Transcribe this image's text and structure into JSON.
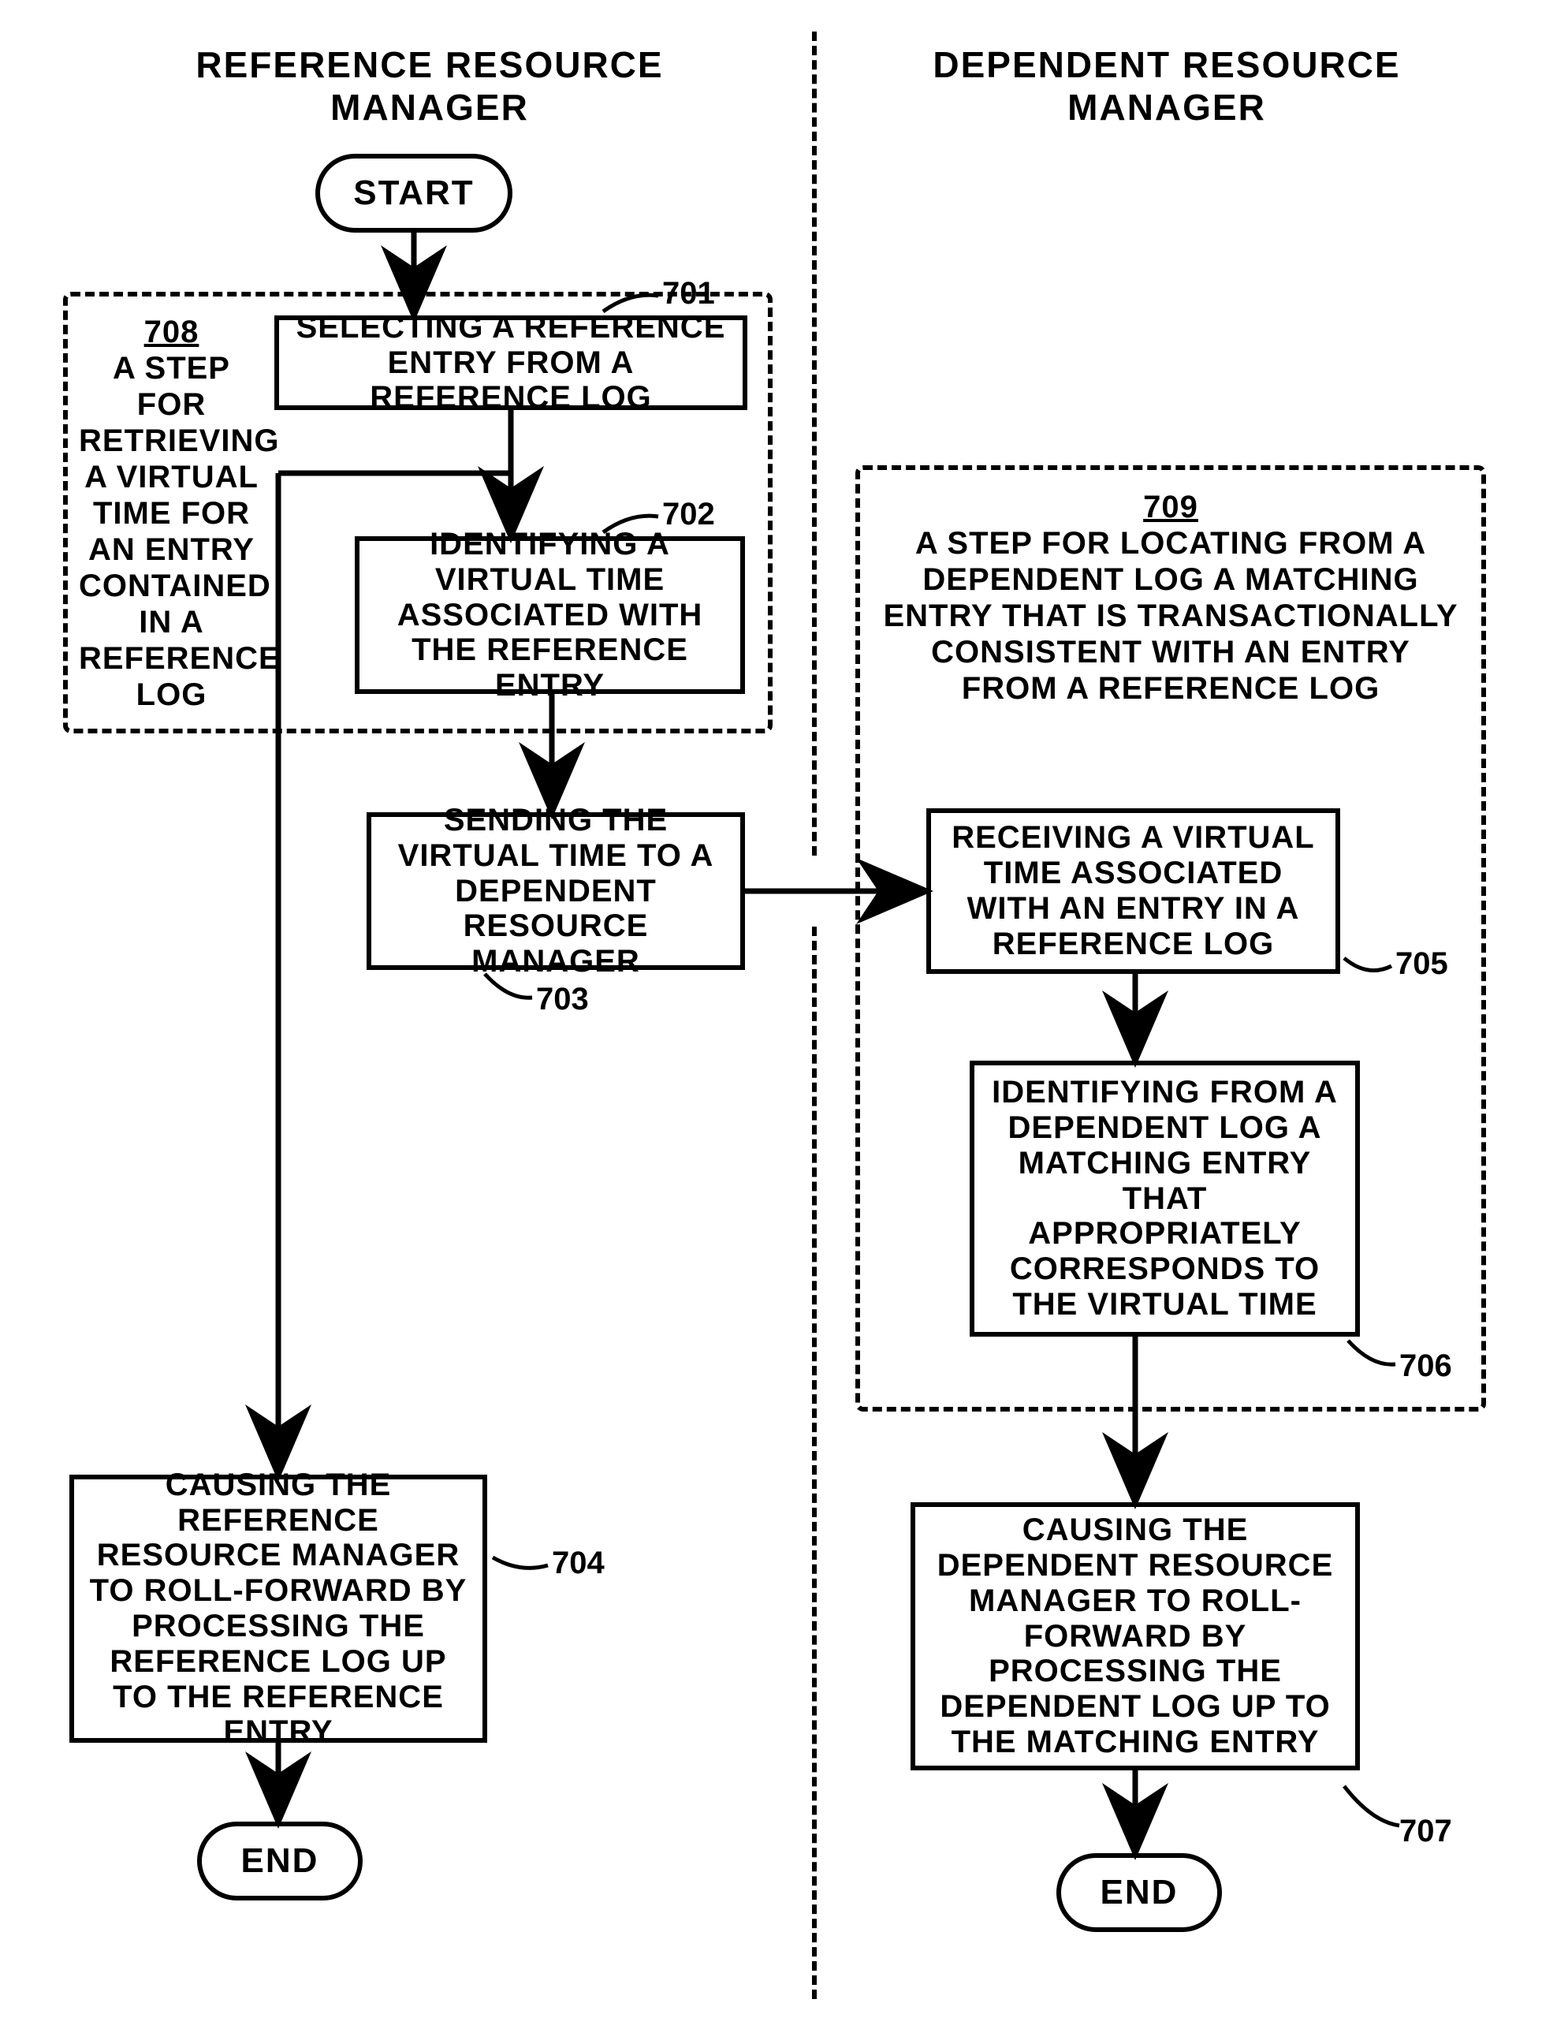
{
  "headers": {
    "left": "REFERENCE RESOURCE MANAGER",
    "right": "DEPENDENT RESOURCE MANAGER"
  },
  "terminals": {
    "start": "START",
    "end_left": "END",
    "end_right": "END"
  },
  "boxes": {
    "b701": "SELECTING A REFERENCE ENTRY FROM A REFERENCE LOG",
    "b702": "IDENTIFYING A VIRTUAL TIME ASSOCIATED WITH THE REFERENCE ENTRY",
    "b703": "SENDING THE VIRTUAL TIME TO A DEPENDENT RESOURCE MANAGER",
    "b704": "CAUSING THE REFERENCE RESOURCE MANAGER TO ROLL-FORWARD BY PROCESSING THE REFERENCE LOG UP TO THE REFERENCE ENTRY",
    "b705": "RECEIVING A VIRTUAL TIME ASSOCIATED WITH AN ENTRY IN A REFERENCE LOG",
    "b706": "IDENTIFYING FROM A DEPENDENT LOG A MATCHING ENTRY THAT APPROPRIATELY CORRESPONDS TO THE VIRTUAL TIME",
    "b707": "CAUSING THE DEPENDENT RESOURCE MANAGER TO ROLL-FORWARD BY PROCESSING THE DEPENDENT LOG UP TO THE MATCHING ENTRY"
  },
  "groups": {
    "g708_num": "708",
    "g708_text": "A STEP FOR RETRIEVING A VIRTUAL TIME FOR AN ENTRY CONTAINED IN A REFERENCE LOG",
    "g709_num": "709",
    "g709_text": "A STEP FOR LOCATING FROM A DEPENDENT LOG A MATCHING ENTRY THAT IS TRANSACTIONALLY CONSISTENT WITH AN ENTRY FROM A REFERENCE LOG"
  },
  "refs": {
    "r701": "701",
    "r702": "702",
    "r703": "703",
    "r704": "704",
    "r705": "705",
    "r706": "706",
    "r707": "707"
  }
}
